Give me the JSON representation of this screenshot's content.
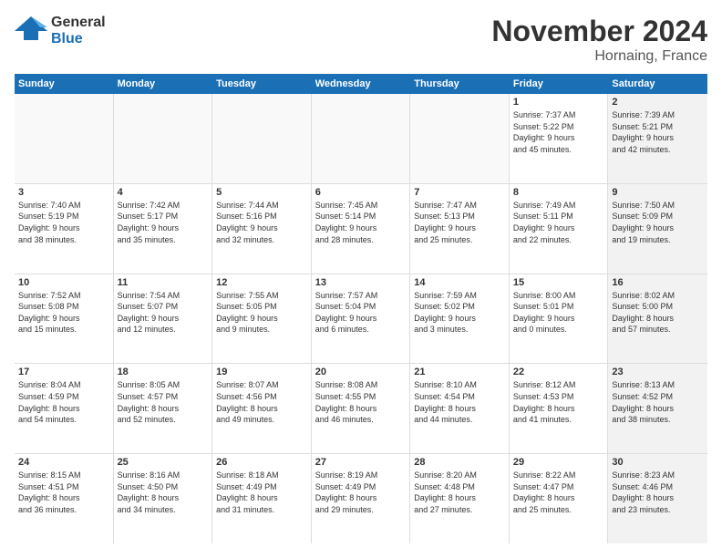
{
  "header": {
    "logo_general": "General",
    "logo_blue": "Blue",
    "month_title": "November 2024",
    "location": "Hornaing, France"
  },
  "days_of_week": [
    "Sunday",
    "Monday",
    "Tuesday",
    "Wednesday",
    "Thursday",
    "Friday",
    "Saturday"
  ],
  "weeks": [
    {
      "cells": [
        {
          "day": "",
          "detail": "",
          "empty": true
        },
        {
          "day": "",
          "detail": "",
          "empty": true
        },
        {
          "day": "",
          "detail": "",
          "empty": true
        },
        {
          "day": "",
          "detail": "",
          "empty": true
        },
        {
          "day": "",
          "detail": "",
          "empty": true
        },
        {
          "day": "1",
          "detail": "Sunrise: 7:37 AM\nSunset: 5:22 PM\nDaylight: 9 hours\nand 45 minutes.",
          "empty": false
        },
        {
          "day": "2",
          "detail": "Sunrise: 7:39 AM\nSunset: 5:21 PM\nDaylight: 9 hours\nand 42 minutes.",
          "empty": false,
          "shaded": true
        }
      ]
    },
    {
      "cells": [
        {
          "day": "3",
          "detail": "Sunrise: 7:40 AM\nSunset: 5:19 PM\nDaylight: 9 hours\nand 38 minutes.",
          "empty": false
        },
        {
          "day": "4",
          "detail": "Sunrise: 7:42 AM\nSunset: 5:17 PM\nDaylight: 9 hours\nand 35 minutes.",
          "empty": false
        },
        {
          "day": "5",
          "detail": "Sunrise: 7:44 AM\nSunset: 5:16 PM\nDaylight: 9 hours\nand 32 minutes.",
          "empty": false
        },
        {
          "day": "6",
          "detail": "Sunrise: 7:45 AM\nSunset: 5:14 PM\nDaylight: 9 hours\nand 28 minutes.",
          "empty": false
        },
        {
          "day": "7",
          "detail": "Sunrise: 7:47 AM\nSunset: 5:13 PM\nDaylight: 9 hours\nand 25 minutes.",
          "empty": false
        },
        {
          "day": "8",
          "detail": "Sunrise: 7:49 AM\nSunset: 5:11 PM\nDaylight: 9 hours\nand 22 minutes.",
          "empty": false
        },
        {
          "day": "9",
          "detail": "Sunrise: 7:50 AM\nSunset: 5:09 PM\nDaylight: 9 hours\nand 19 minutes.",
          "empty": false,
          "shaded": true
        }
      ]
    },
    {
      "cells": [
        {
          "day": "10",
          "detail": "Sunrise: 7:52 AM\nSunset: 5:08 PM\nDaylight: 9 hours\nand 15 minutes.",
          "empty": false
        },
        {
          "day": "11",
          "detail": "Sunrise: 7:54 AM\nSunset: 5:07 PM\nDaylight: 9 hours\nand 12 minutes.",
          "empty": false
        },
        {
          "day": "12",
          "detail": "Sunrise: 7:55 AM\nSunset: 5:05 PM\nDaylight: 9 hours\nand 9 minutes.",
          "empty": false
        },
        {
          "day": "13",
          "detail": "Sunrise: 7:57 AM\nSunset: 5:04 PM\nDaylight: 9 hours\nand 6 minutes.",
          "empty": false
        },
        {
          "day": "14",
          "detail": "Sunrise: 7:59 AM\nSunset: 5:02 PM\nDaylight: 9 hours\nand 3 minutes.",
          "empty": false
        },
        {
          "day": "15",
          "detail": "Sunrise: 8:00 AM\nSunset: 5:01 PM\nDaylight: 9 hours\nand 0 minutes.",
          "empty": false
        },
        {
          "day": "16",
          "detail": "Sunrise: 8:02 AM\nSunset: 5:00 PM\nDaylight: 8 hours\nand 57 minutes.",
          "empty": false,
          "shaded": true
        }
      ]
    },
    {
      "cells": [
        {
          "day": "17",
          "detail": "Sunrise: 8:04 AM\nSunset: 4:59 PM\nDaylight: 8 hours\nand 54 minutes.",
          "empty": false
        },
        {
          "day": "18",
          "detail": "Sunrise: 8:05 AM\nSunset: 4:57 PM\nDaylight: 8 hours\nand 52 minutes.",
          "empty": false
        },
        {
          "day": "19",
          "detail": "Sunrise: 8:07 AM\nSunset: 4:56 PM\nDaylight: 8 hours\nand 49 minutes.",
          "empty": false
        },
        {
          "day": "20",
          "detail": "Sunrise: 8:08 AM\nSunset: 4:55 PM\nDaylight: 8 hours\nand 46 minutes.",
          "empty": false
        },
        {
          "day": "21",
          "detail": "Sunrise: 8:10 AM\nSunset: 4:54 PM\nDaylight: 8 hours\nand 44 minutes.",
          "empty": false
        },
        {
          "day": "22",
          "detail": "Sunrise: 8:12 AM\nSunset: 4:53 PM\nDaylight: 8 hours\nand 41 minutes.",
          "empty": false
        },
        {
          "day": "23",
          "detail": "Sunrise: 8:13 AM\nSunset: 4:52 PM\nDaylight: 8 hours\nand 38 minutes.",
          "empty": false,
          "shaded": true
        }
      ]
    },
    {
      "cells": [
        {
          "day": "24",
          "detail": "Sunrise: 8:15 AM\nSunset: 4:51 PM\nDaylight: 8 hours\nand 36 minutes.",
          "empty": false
        },
        {
          "day": "25",
          "detail": "Sunrise: 8:16 AM\nSunset: 4:50 PM\nDaylight: 8 hours\nand 34 minutes.",
          "empty": false
        },
        {
          "day": "26",
          "detail": "Sunrise: 8:18 AM\nSunset: 4:49 PM\nDaylight: 8 hours\nand 31 minutes.",
          "empty": false
        },
        {
          "day": "27",
          "detail": "Sunrise: 8:19 AM\nSunset: 4:49 PM\nDaylight: 8 hours\nand 29 minutes.",
          "empty": false
        },
        {
          "day": "28",
          "detail": "Sunrise: 8:20 AM\nSunset: 4:48 PM\nDaylight: 8 hours\nand 27 minutes.",
          "empty": false
        },
        {
          "day": "29",
          "detail": "Sunrise: 8:22 AM\nSunset: 4:47 PM\nDaylight: 8 hours\nand 25 minutes.",
          "empty": false
        },
        {
          "day": "30",
          "detail": "Sunrise: 8:23 AM\nSunset: 4:46 PM\nDaylight: 8 hours\nand 23 minutes.",
          "empty": false,
          "shaded": true
        }
      ]
    }
  ]
}
